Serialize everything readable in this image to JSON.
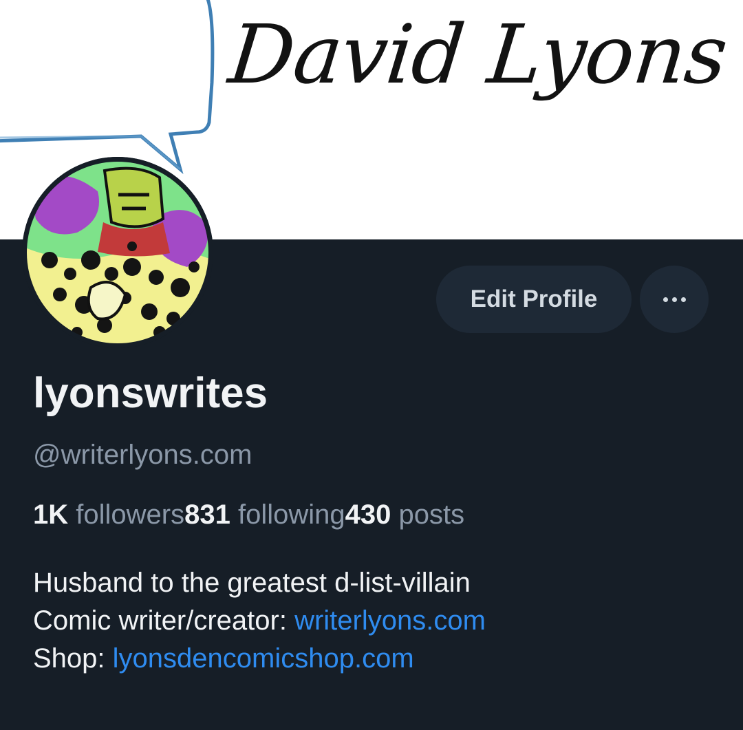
{
  "banner": {
    "title": "David Lyons"
  },
  "profile": {
    "display_name": "lyonswrites",
    "handle": "@writerlyons.com",
    "stats": {
      "followers_count": "1K",
      "followers_label": "followers",
      "following_count": "831",
      "following_label": "following",
      "posts_count": "430",
      "posts_label": "posts"
    },
    "bio": {
      "line1": "Husband to the greatest d-list-villain",
      "line2_prefix": "Comic writer/creator: ",
      "line2_link": "writerlyons.com",
      "line3_prefix": "Shop: ",
      "line3_link": "lyonsdencomicshop.com"
    }
  },
  "actions": {
    "edit_profile_label": "Edit Profile",
    "more_icon": "ellipsis-icon"
  },
  "colors": {
    "background": "#161e27",
    "button_bg": "#1e2936",
    "link": "#2f8cf0",
    "muted_text": "#8b98a8",
    "primary_text": "#f1f3f5"
  }
}
